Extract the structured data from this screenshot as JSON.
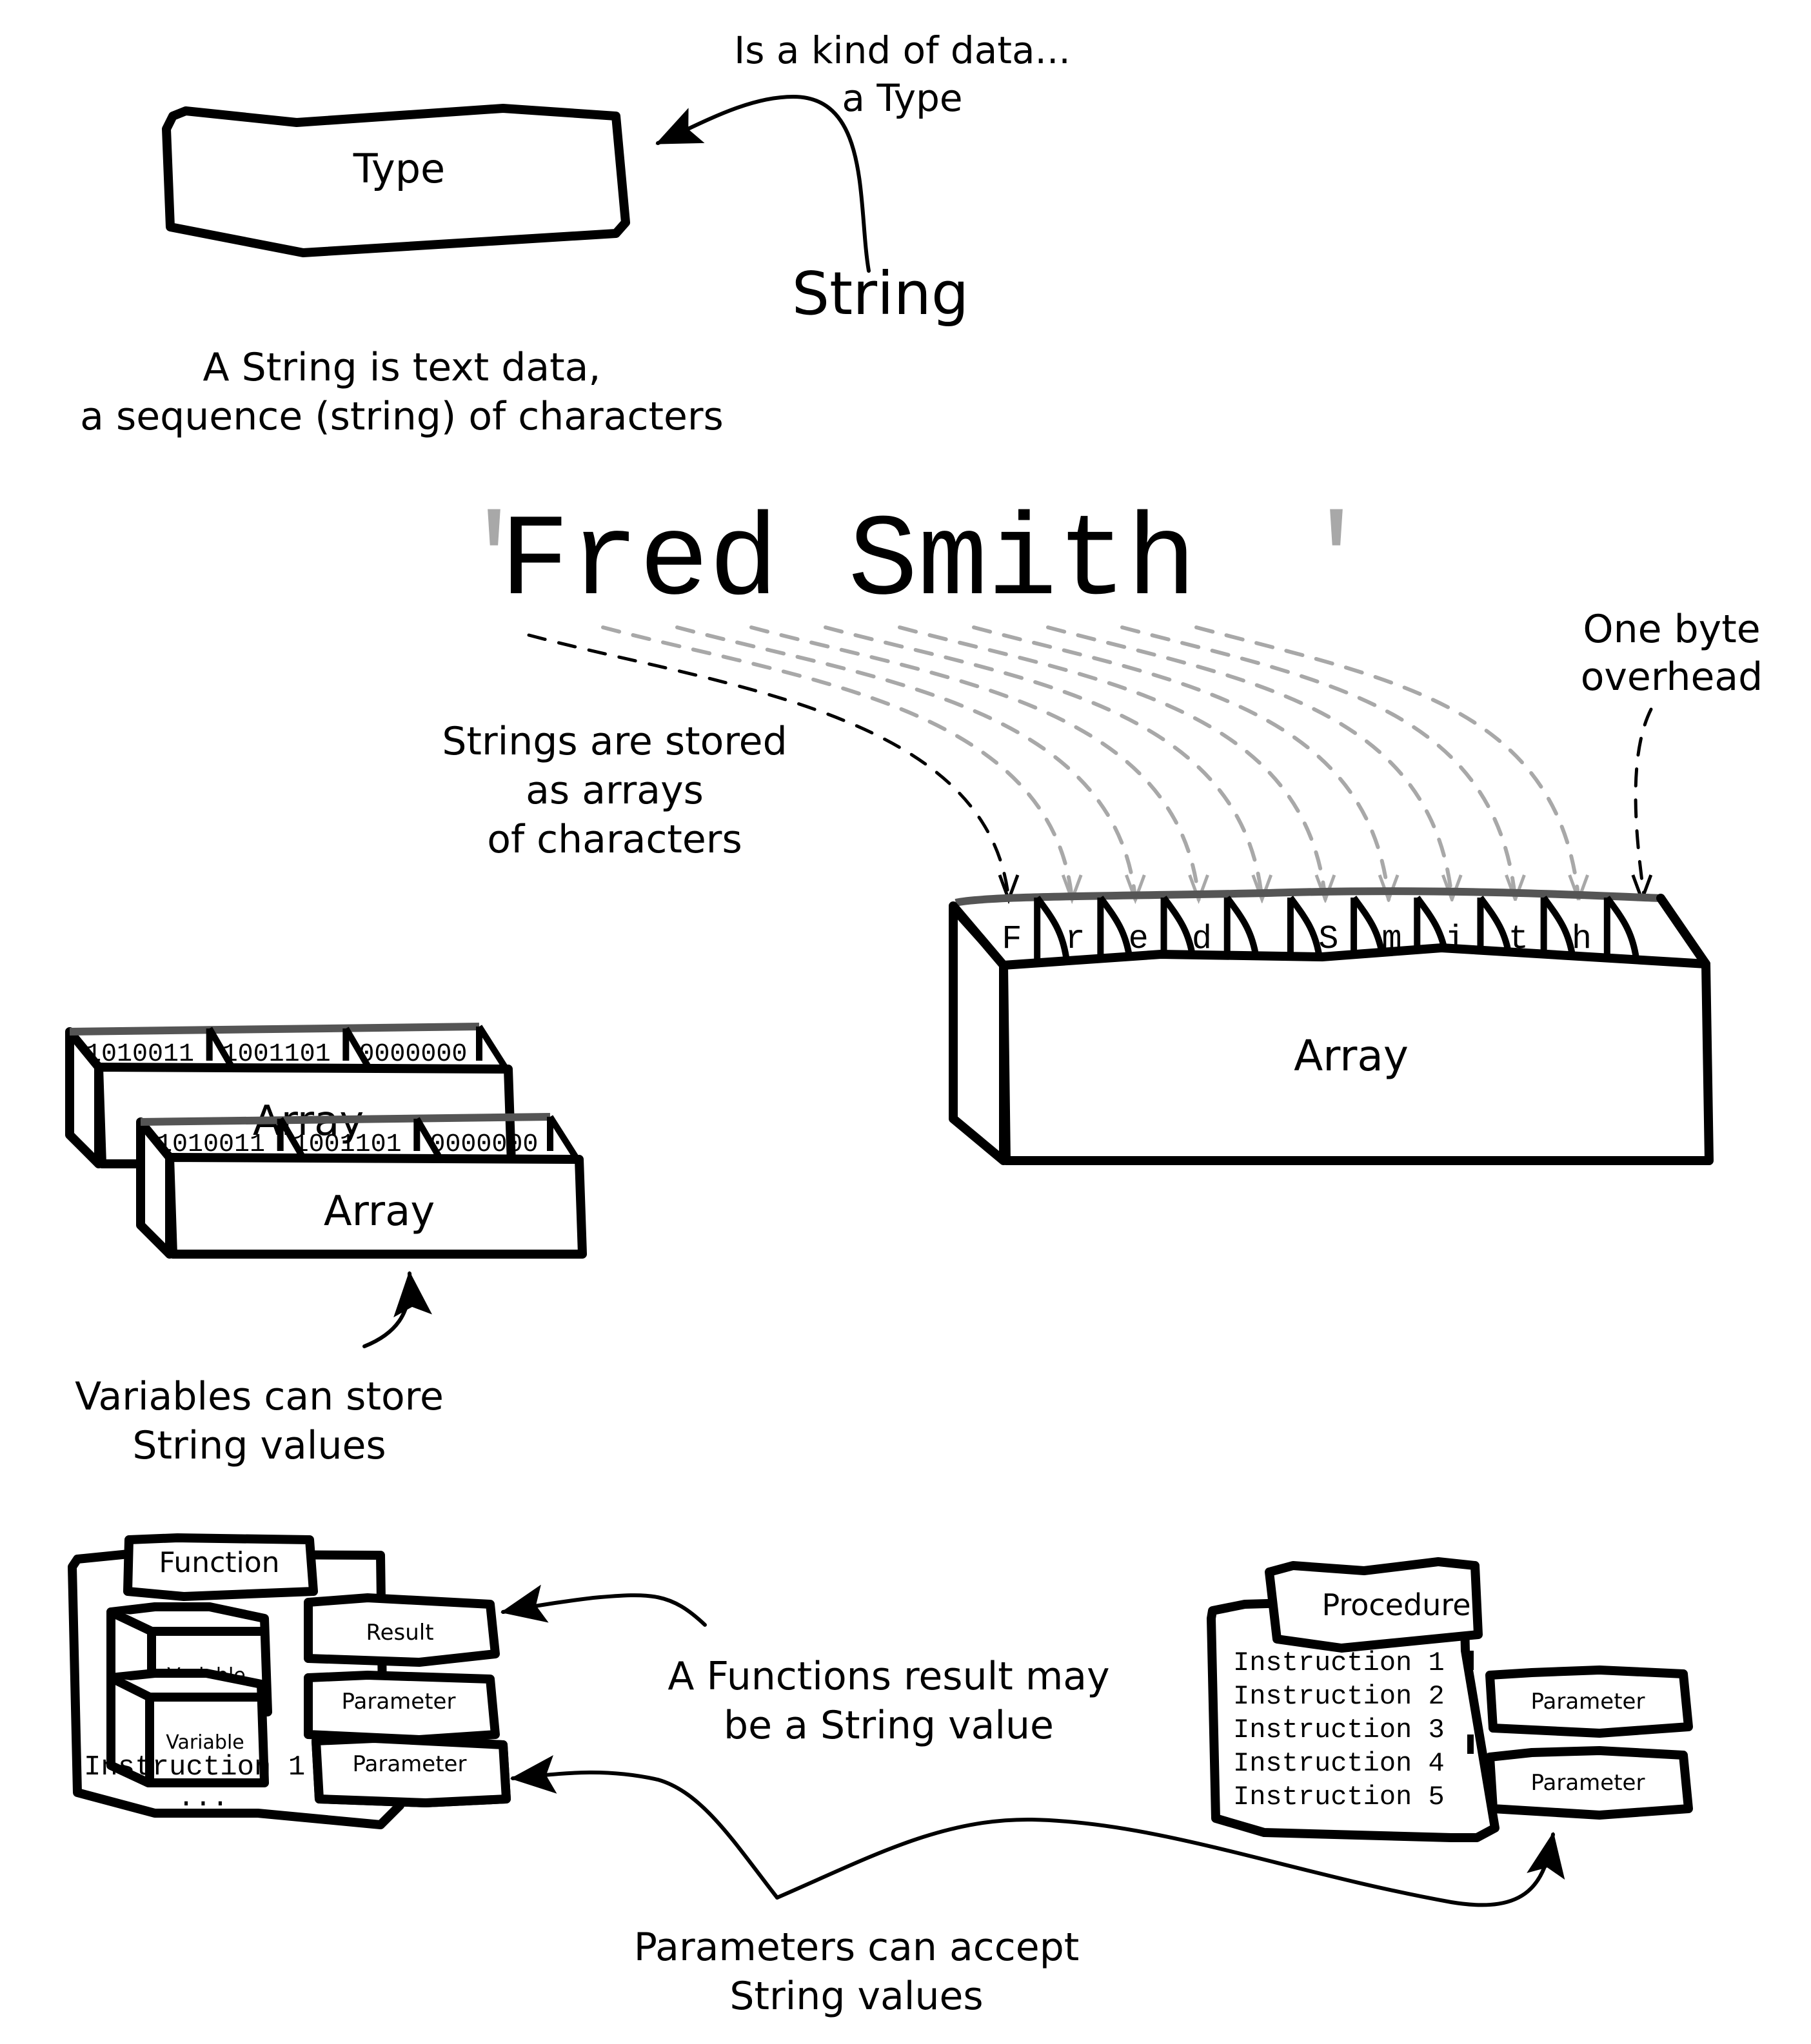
{
  "type_box": {
    "label": "Type"
  },
  "type_note": {
    "line1": "Is a kind of data...",
    "line2": "a Type"
  },
  "string_title": "String",
  "string_definition": {
    "line1": "A String is text data,",
    "line2": "a sequence (string) of characters"
  },
  "example_literal": {
    "quote_open": "'",
    "text": "Fred Smith",
    "quote_close": "'"
  },
  "storage_note": {
    "line1": "Strings are stored",
    "line2": "as arrays",
    "line3": "of characters"
  },
  "overhead_note": {
    "line1": "One byte",
    "line2": "overhead"
  },
  "big_array": {
    "label": "Array",
    "cells": [
      "F",
      "r",
      "e",
      "d",
      " ",
      "S",
      "m",
      "i",
      "t",
      "h",
      ""
    ]
  },
  "variable_arrays": {
    "label": "Array",
    "cells": [
      "1010011",
      "1001101",
      "0000000"
    ]
  },
  "variables_note": {
    "line1": "Variables can store",
    "line2": "String values"
  },
  "function_block": {
    "title": "Function",
    "variables": [
      "Variable",
      "Variable"
    ],
    "result": "Result",
    "parameters": [
      "Parameter",
      "Parameter"
    ],
    "instruction": "Instruction 1",
    "ellipsis": "..."
  },
  "procedure_block": {
    "title": "Procedure",
    "instructions": [
      "Instruction 1",
      "Instruction 2",
      "Instruction 3",
      "Instruction 4",
      "Instruction 5"
    ],
    "parameters": [
      "Parameter",
      "Parameter"
    ]
  },
  "function_result_note": {
    "line1": "A Functions result may",
    "line2": "be a String value"
  },
  "parameters_note": {
    "line1": "Parameters can accept",
    "line2": "String values"
  },
  "colors": {
    "ink": "#000000",
    "faint": "#a8a8a8",
    "strip": "#555555",
    "background": "#ffffff"
  }
}
